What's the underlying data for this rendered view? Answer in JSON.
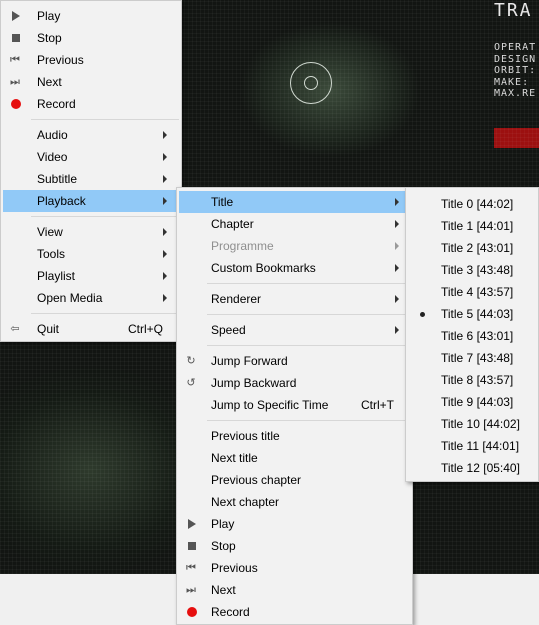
{
  "video": {
    "title_text": "TRA",
    "hud_lines": [
      "OPERAT",
      "DESIGN",
      "ORBIT:",
      "MAKE:",
      "MAX.RE"
    ]
  },
  "main_menu": {
    "items": [
      {
        "label": "Play",
        "icon": "play-icon"
      },
      {
        "label": "Stop",
        "icon": "stop-icon"
      },
      {
        "label": "Previous",
        "icon": "previous-icon"
      },
      {
        "label": "Next",
        "icon": "next-icon"
      },
      {
        "label": "Record",
        "icon": "record-icon"
      },
      {
        "label": "Audio"
      },
      {
        "label": "Video"
      },
      {
        "label": "Subtitle"
      },
      {
        "label": "Playback"
      },
      {
        "label": "View"
      },
      {
        "label": "Tools"
      },
      {
        "label": "Playlist"
      },
      {
        "label": "Open Media"
      },
      {
        "label": "Quit",
        "shortcut": "Ctrl+Q",
        "icon": "exit-icon"
      }
    ]
  },
  "playback_menu": {
    "items": [
      {
        "label": "Title"
      },
      {
        "label": "Chapter"
      },
      {
        "label": "Programme"
      },
      {
        "label": "Custom Bookmarks"
      },
      {
        "label": "Renderer"
      },
      {
        "label": "Speed"
      },
      {
        "label": "Jump Forward",
        "icon": "jump-forward-icon"
      },
      {
        "label": "Jump Backward",
        "icon": "jump-backward-icon"
      },
      {
        "label": "Jump to Specific Time",
        "shortcut": "Ctrl+T"
      },
      {
        "label": "Previous title"
      },
      {
        "label": "Next title"
      },
      {
        "label": "Previous chapter"
      },
      {
        "label": "Next chapter"
      },
      {
        "label": "Play",
        "icon": "play-icon"
      },
      {
        "label": "Stop",
        "icon": "stop-icon"
      },
      {
        "label": "Previous",
        "icon": "previous-icon"
      },
      {
        "label": "Next",
        "icon": "next-icon"
      },
      {
        "label": "Record",
        "icon": "record-icon"
      }
    ]
  },
  "title_menu": {
    "selected_index": 5,
    "items": [
      "Title 0 [44:02]",
      "Title 1 [44:01]",
      "Title 2 [43:01]",
      "Title 3 [43:48]",
      "Title 4 [43:57]",
      "Title 5 [44:03]",
      "Title 6 [43:01]",
      "Title 7 [43:48]",
      "Title 8 [43:57]",
      "Title 9 [44:03]",
      "Title 10 [44:02]",
      "Title 11 [44:01]",
      "Title 12 [05:40]"
    ]
  },
  "colors": {
    "highlight": "#91c9f7",
    "record": "#e60f0f",
    "menu_bg": "#f2f2f2"
  }
}
